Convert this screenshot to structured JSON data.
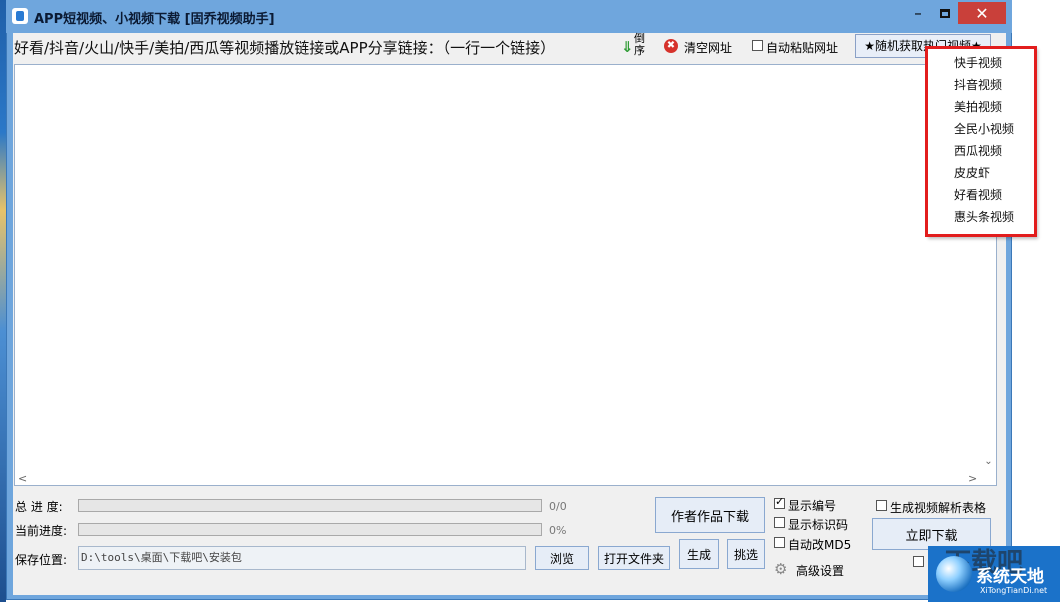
{
  "window": {
    "title": "APP短视频、小视频下载 [固乔视频助手]",
    "min_glyph": "–",
    "close_glyph": "✕"
  },
  "toolbar": {
    "prompt": "好看/抖音/火山/快手/美拍/西瓜等视频播放链接或APP分享链接：（一行一个链接）",
    "reverse_label": "倒序",
    "clear_icon": "✖",
    "clear_label": "清空网址",
    "auto_paste_label": "自动粘贴网址",
    "auto_paste_checked": false,
    "hot_button_label": "★随机获取热门视频★"
  },
  "url_list": {
    "value": "",
    "scroll_left": "<",
    "scroll_right": ">",
    "scroll_down": "⌄"
  },
  "progress": {
    "total_label": "总 进 度:",
    "total_text": "0/0",
    "total_fraction": 0,
    "current_label": "当前进度:",
    "current_text": "0%",
    "current_fraction": 0
  },
  "save": {
    "label": "保存位置:",
    "path": "D:\\tools\\桌面\\下载吧\\安装包",
    "browse_label": "浏览",
    "open_folder_label": "打开文件夹"
  },
  "actions": {
    "author_download_label": "作者作品下载",
    "generate_label": "生成",
    "pick_label": "挑选",
    "download_now_label": "立即下载"
  },
  "options": {
    "show_number": {
      "label": "显示编号",
      "checked": true
    },
    "show_id": {
      "label": "显示标识码",
      "checked": false
    },
    "auto_md5": {
      "label": "自动改MD5",
      "checked": false
    },
    "gen_table": {
      "label": "生成视频解析表格",
      "checked": false
    },
    "advanced_label": "高级设置",
    "gear_icon": "⚙"
  },
  "popup_menu": {
    "items": [
      "快手视频",
      "抖音视频",
      "美拍视频",
      "全民小视频",
      "西瓜视频",
      "皮皮虾",
      "好看视频",
      "惠头条视频"
    ],
    "highlight_color": "#e21d1d"
  },
  "watermark": {
    "bg_text": "下载吧",
    "title": "系统天地",
    "url": "XiTongTianDi.net"
  },
  "colors": {
    "title_bar": "#6fa6dd",
    "close_button": "#c9403a",
    "button_face": "#e6edf7"
  }
}
